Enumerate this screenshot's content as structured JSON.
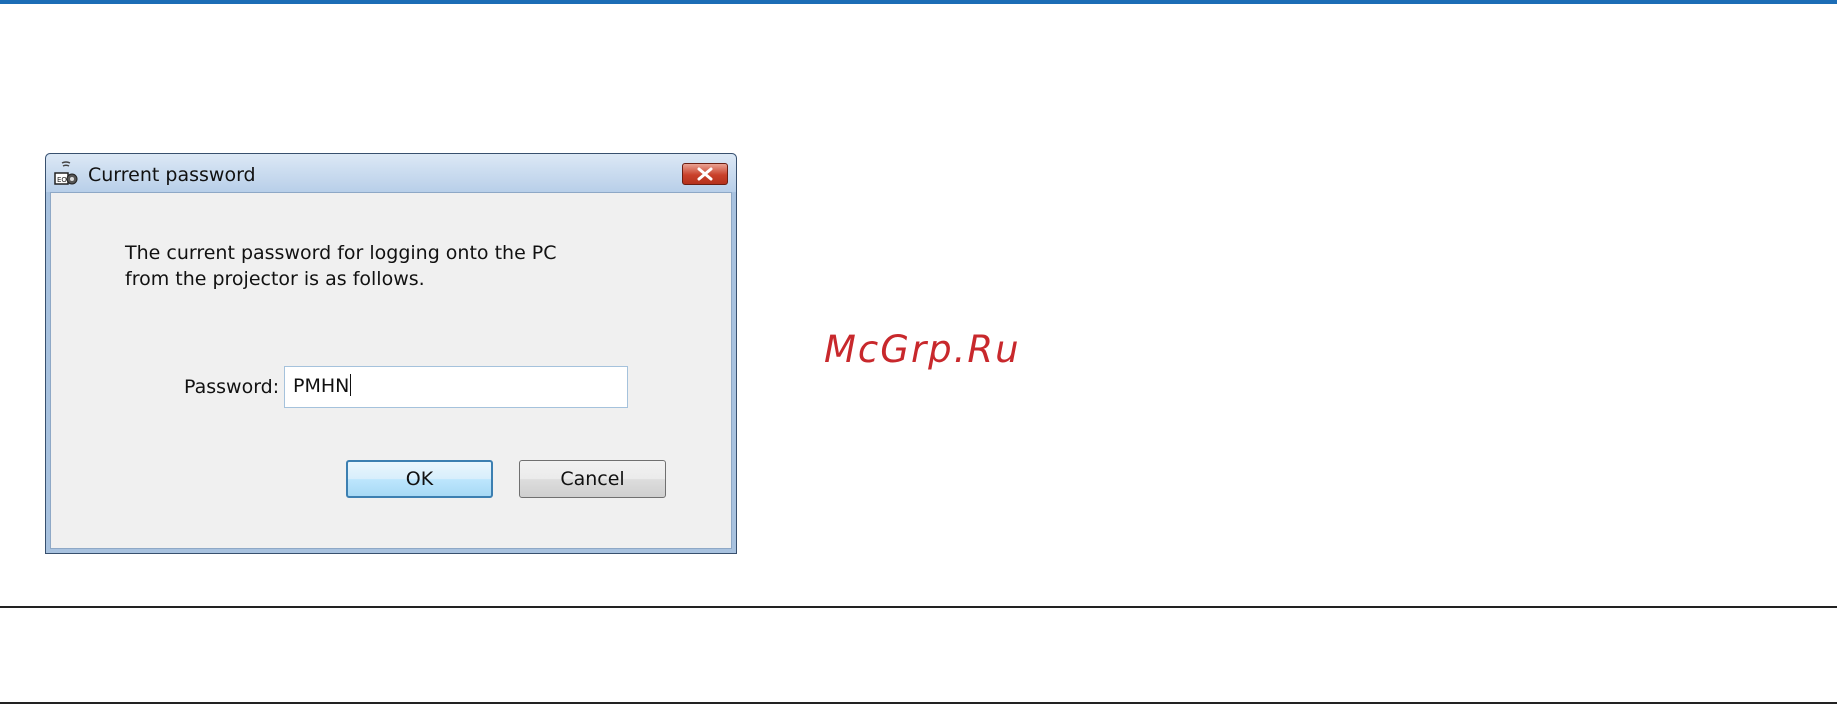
{
  "dialog": {
    "title": "Current password",
    "message": "The current password for logging onto the PC\nfrom the projector is as follows.",
    "password_label": "Password:",
    "password_value": "PMHN",
    "ok_label": "OK",
    "cancel_label": "Cancel",
    "icons": {
      "app": "projector-network-icon",
      "close": "close-icon"
    }
  },
  "watermark": "McGrp.Ru",
  "colors": {
    "top_rule": "#1c6db6",
    "watermark": "#c8282c",
    "close_button": "#c9412a",
    "ok_border": "#3c7fb1"
  }
}
